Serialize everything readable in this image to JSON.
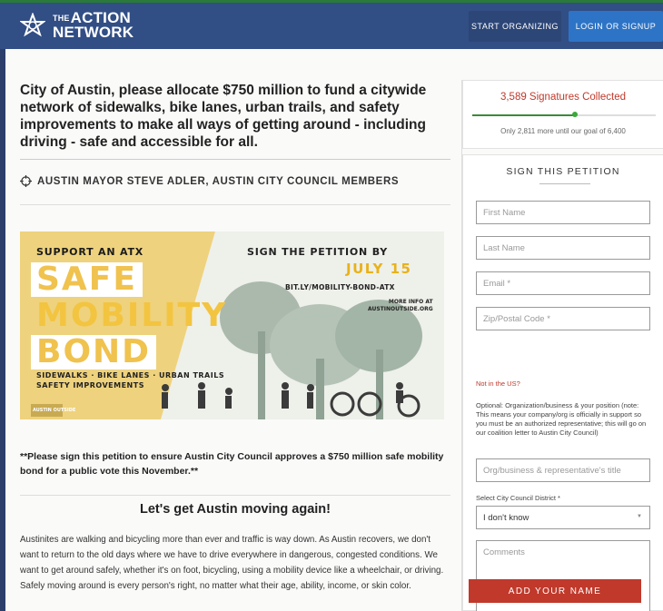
{
  "header": {
    "logo_small": "THE",
    "logo_line1": "ACTION",
    "logo_line2": "NETWORK",
    "start_label": "START ORGANIZING",
    "login_label": "LOGIN OR SIGNUP"
  },
  "petition": {
    "title": "City of Austin, please allocate $750 million to fund a citywide network of sidewalks, bike lanes, urban trails, and safety improvements to make all ways of getting around - including driving - safe and accessible for all.",
    "target": "AUSTIN MAYOR STEVE ADLER, AUSTIN CITY COUNCIL MEMBERS",
    "banner": {
      "support": "SUPPORT AN ATX",
      "safe": "SAFE",
      "mobility": "MOBILITY",
      "bond": "BOND",
      "sign": "SIGN THE PETITION BY",
      "date": "JULY 15",
      "url": "BIT.LY/MOBILITY-BOND-ATX",
      "more_info_1": "MORE INFO AT",
      "more_info_2": "AUSTINOUTSIDE.ORG",
      "tags_1": "SIDEWALKS · BIKE LANES · URBAN TRAILS",
      "tags_2": "SAFETY IMPROVEMENTS",
      "org_logo": "AUSTIN OUTSIDE"
    },
    "note": "**Please sign this petition to ensure Austin City Council approves a $750 million safe mobility bond for a public vote this November.**",
    "subhead": "Let's get Austin moving again!",
    "body": "Austinites are walking and bicycling more than ever and traffic is way down. As Austin recovers, we don't want to return to the old days where we have to drive everywhere in dangerous, congested conditions. We want to get around safely, whether it's on foot, bicycling, using a mobility device like a wheelchair, or driving. Safely moving around is every person's right, no matter what their age, ability, income, or skin color."
  },
  "signatures": {
    "count_text": "3,589 Signatures Collected",
    "progress": 0.56,
    "goal_text": "Only 2,811 more until our goal of 6,400"
  },
  "form": {
    "heading": "SIGN THIS PETITION",
    "first_name": "First Name",
    "last_name": "Last Name",
    "email": "Email *",
    "zip": "Zip/Postal Code *",
    "not_us": "Not in the US?",
    "optional_note": "Optional: Organization/business & your position (note: This means your company/org is officially in support so you must be an authorized representative; this will go on our coalition letter to Austin City Council)",
    "org_placeholder": "Org/business & representative's title",
    "district_label": "Select City Council District *",
    "district_value": "I don't know",
    "comments_placeholder": "Comments",
    "submit_label": "ADD YOUR NAME"
  },
  "colors": {
    "header": "#314e85",
    "accent_red": "#c0392b",
    "banner_yellow": "#f0c24e",
    "login_blue": "#2d74c6"
  }
}
